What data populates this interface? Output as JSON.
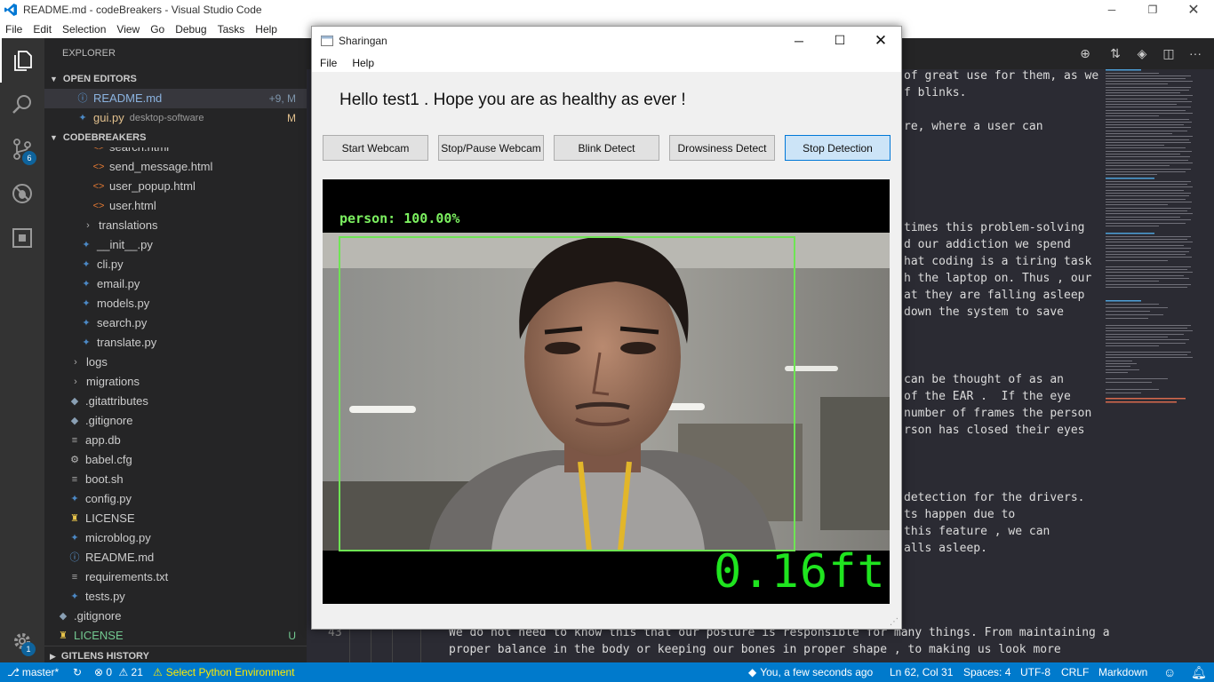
{
  "vscode": {
    "window_title": "README.md - codeBreakers - Visual Studio Code",
    "menu": [
      "File",
      "Edit",
      "Selection",
      "View",
      "Go",
      "Debug",
      "Tasks",
      "Help"
    ],
    "activity": {
      "scm_badge": "6",
      "settings_badge": "1"
    },
    "sidebar": {
      "header": "EXPLORER",
      "open_editors_title": "OPEN EDITORS",
      "open_editors": [
        {
          "name": "README.md",
          "status": "+9, M"
        },
        {
          "name": "gui.py",
          "path": "desktop-software",
          "status": "M"
        }
      ],
      "project_title": "CODEBREAKERS",
      "tree": [
        {
          "name": "search.html"
        },
        {
          "name": "send_message.html"
        },
        {
          "name": "user_popup.html"
        },
        {
          "name": "user.html"
        },
        {
          "name": "translations"
        },
        {
          "name": "__init__.py"
        },
        {
          "name": "cli.py"
        },
        {
          "name": "email.py"
        },
        {
          "name": "models.py"
        },
        {
          "name": "search.py"
        },
        {
          "name": "translate.py"
        },
        {
          "name": "logs"
        },
        {
          "name": "migrations"
        },
        {
          "name": ".gitattributes"
        },
        {
          "name": ".gitignore"
        },
        {
          "name": "app.db"
        },
        {
          "name": "babel.cfg"
        },
        {
          "name": "boot.sh"
        },
        {
          "name": "config.py"
        },
        {
          "name": "LICENSE"
        },
        {
          "name": "microblog.py"
        },
        {
          "name": "README.md"
        },
        {
          "name": "requirements.txt"
        },
        {
          "name": "tests.py"
        },
        {
          "name": ".gitignore"
        },
        {
          "name": "LICENSE",
          "status": "U"
        }
      ],
      "gitlens_title": "GITLENS HISTORY"
    },
    "editor": {
      "lines": [
        "of great use for them, as we",
        "f blinks.",
        "re, where a user can",
        "times this problem-solving",
        "d our addiction we spend",
        "hat coding is a tiring task",
        "h the laptop on. Thus , our",
        "at they are falling asleep",
        "down the system to save",
        "can be thought of as an",
        "of the EAR .  If the eye",
        "number of frames the person",
        "rson has closed their eyes",
        "detection for the drivers.",
        "ts happen due to",
        "this feature , we can",
        "alls asleep."
      ],
      "line_number": "43",
      "bottom_lines": [
        "We do not need to know this that our posture is responsible for many things. From maintaining a",
        "proper balance in the body or keeping our bones in proper shape , to making us look more"
      ]
    },
    "status": {
      "branch": "master*",
      "errors": "0",
      "warnings": "21",
      "python_env": "Select Python Environment",
      "blame": "You, a few seconds ago",
      "position": "Ln 62, Col 31",
      "spaces": "Spaces: 4",
      "encoding": "UTF-8",
      "eol": "CRLF",
      "language": "Markdown"
    }
  },
  "app": {
    "title": "Sharingan",
    "menu": [
      "File",
      "Help"
    ],
    "greeting": "Hello test1 . Hope you are as healthy as ever !",
    "buttons": [
      "Start Webcam",
      "Stop/Pause Webcam",
      "Blink Detect",
      "Drowsiness Detect",
      "Stop Detection"
    ],
    "detection_label": "person: 100.00%",
    "distance": "0.16ft"
  },
  "colors": {
    "accent": "#007acc",
    "detection_green": "#6fe454",
    "active_button": "#cce4f7",
    "modified": "#e2c08d",
    "untracked": "#73c991"
  }
}
